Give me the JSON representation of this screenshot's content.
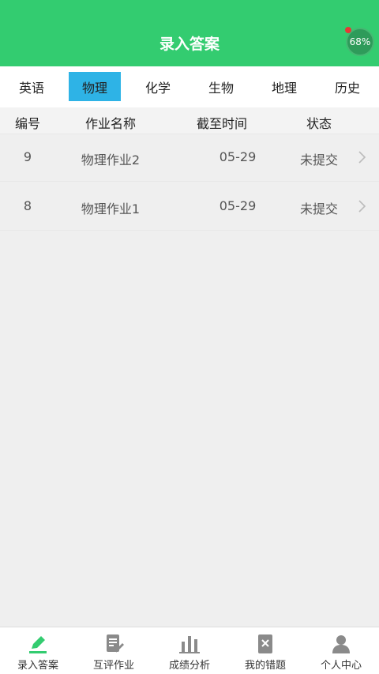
{
  "header": {
    "title": "录入答案",
    "battery": "68%"
  },
  "tabs": [
    "英语",
    "物理",
    "化学",
    "生物",
    "地理",
    "历史"
  ],
  "active_tab": "物理",
  "table": {
    "columns": [
      "编号",
      "作业名称",
      "截至时间",
      "状态"
    ],
    "rows": [
      {
        "id": "9",
        "name": "物理作业2",
        "deadline": "05-29",
        "status": "未提交"
      },
      {
        "id": "8",
        "name": "物理作业1",
        "deadline": "05-29",
        "status": "未提交"
      }
    ]
  },
  "bottom_nav": [
    {
      "label": "录入答案",
      "icon": "pencil-icon",
      "active": true
    },
    {
      "label": "互评作业",
      "icon": "document-edit-icon",
      "active": false
    },
    {
      "label": "成绩分析",
      "icon": "bar-chart-icon",
      "active": false
    },
    {
      "label": "我的错题",
      "icon": "error-book-icon",
      "active": false
    },
    {
      "label": "个人中心",
      "icon": "person-icon",
      "active": false
    }
  ],
  "colors": {
    "primary": "#33cc70",
    "active_tab": "#2eb3e6",
    "icon_gray": "#8a8a8a"
  }
}
